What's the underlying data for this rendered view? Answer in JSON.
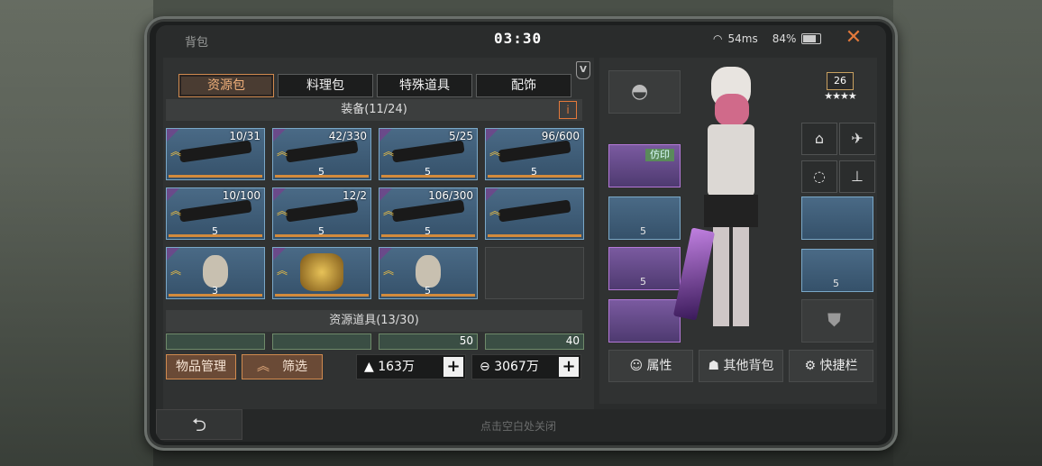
{
  "window": {
    "title": "背包",
    "time": "03:30",
    "wifi": "54ms",
    "battery": "84%"
  },
  "tabs": [
    "资源包",
    "料理包",
    "特殊道具",
    "配饰"
  ],
  "active_tab": 0,
  "vip_badge": "V",
  "equipment": {
    "header": "装备(11/24)",
    "info_icon": "i",
    "items": [
      {
        "count": "10/31",
        "level": "",
        "kind": "rifle"
      },
      {
        "count": "42/330",
        "level": "5",
        "kind": "rifle"
      },
      {
        "count": "5/25",
        "level": "5",
        "kind": "rifle"
      },
      {
        "count": "96/600",
        "level": "5",
        "kind": "rifle"
      },
      {
        "count": "10/100",
        "level": "5",
        "kind": "pistol"
      },
      {
        "count": "12/2",
        "level": "5",
        "kind": "red-gun"
      },
      {
        "count": "106/300",
        "level": "5",
        "kind": "rifle"
      },
      {
        "count": "",
        "level": "",
        "kind": "blade"
      },
      {
        "count": "",
        "level": "3",
        "kind": "mask"
      },
      {
        "count": "",
        "level": "",
        "kind": "gold-armor"
      },
      {
        "count": "",
        "level": "5",
        "kind": "helmet"
      },
      {
        "count": "",
        "level": "",
        "kind": "empty"
      }
    ]
  },
  "resources": {
    "header": "资源道具(13/30)",
    "items": [
      "",
      "",
      "50",
      "40"
    ]
  },
  "buttons": {
    "manage": "物品管理",
    "filter": "筛选"
  },
  "currency": [
    {
      "value": "163万",
      "icon": "gold-bar-icon"
    },
    {
      "value": "3067万",
      "icon": "coin-icon"
    }
  ],
  "footer": {
    "hint": "点击空白处关闭",
    "back": "⮌"
  },
  "character": {
    "level": "26",
    "stars": "★★★★",
    "imitation_tag": "仿印",
    "slot_levels": [
      "5",
      "5",
      "5"
    ],
    "actions": [
      "属性",
      "其他背包",
      "快捷栏"
    ]
  }
}
